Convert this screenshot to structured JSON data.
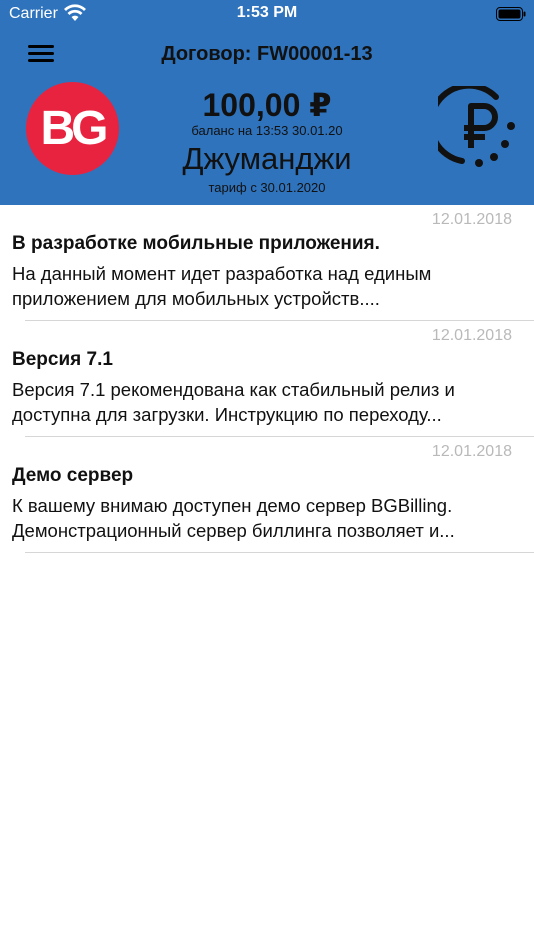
{
  "status_bar": {
    "carrier": "Carrier",
    "time": "1:53 PM"
  },
  "header": {
    "contract_label": "Договор: FW00001-13",
    "logo_text": "BG",
    "balance": "100,00 ₽",
    "balance_date": "баланс на 13:53 30.01.20",
    "tariff_name": "Джуманджи",
    "tariff_date": "тариф с 30.01.2020",
    "colors": {
      "background": "#2f73bc",
      "logo": "#e8233f"
    }
  },
  "news": [
    {
      "date": "12.01.2018",
      "title": "В разработке мобильные приложения.",
      "lines": [
        "На данный момент идет разработка над единым",
        "приложением для мобильных устройств...."
      ]
    },
    {
      "date": "12.01.2018",
      "title": "Версия 7.1",
      "lines": [
        "Версия 7.1 рекомендована как стабильный релиз и",
        "доступна для загрузки. Инструкцию по переходу..."
      ]
    },
    {
      "date": "12.01.2018",
      "title": "Демо сервер",
      "lines": [
        "К вашему внимаю доступен демо сервер BGBilling.",
        "Демонстрационный сервер биллинга позволяет и..."
      ]
    }
  ]
}
